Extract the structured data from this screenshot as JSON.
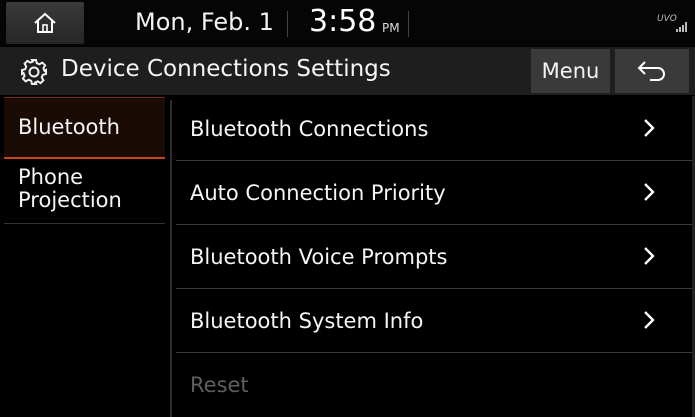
{
  "status_bar": {
    "date": "Mon, Feb. 1",
    "time": "3:58",
    "ampm": "PM",
    "brand": "UVO"
  },
  "header": {
    "title": "Device Connections Settings",
    "menu_label": "Menu"
  },
  "tabs": [
    {
      "label": "Bluetooth",
      "selected": true
    },
    {
      "label_line1": "Phone",
      "label_line2": "Projection",
      "selected": false
    }
  ],
  "list": {
    "items": [
      {
        "label": "Bluetooth Connections",
        "enabled": true
      },
      {
        "label": "Auto Connection Priority",
        "enabled": true
      },
      {
        "label": "Bluetooth Voice Prompts",
        "enabled": true
      },
      {
        "label": "Bluetooth System Info",
        "enabled": true
      },
      {
        "label": "Reset",
        "enabled": false
      }
    ]
  },
  "colors": {
    "background": "#000000",
    "accent": "#c5461a",
    "button": "#3a3a3a",
    "disabled_text": "#5e5e5e"
  },
  "icons": [
    "home-icon",
    "gear-icon",
    "back-icon",
    "chevron-right-icon",
    "signal-icon"
  ]
}
